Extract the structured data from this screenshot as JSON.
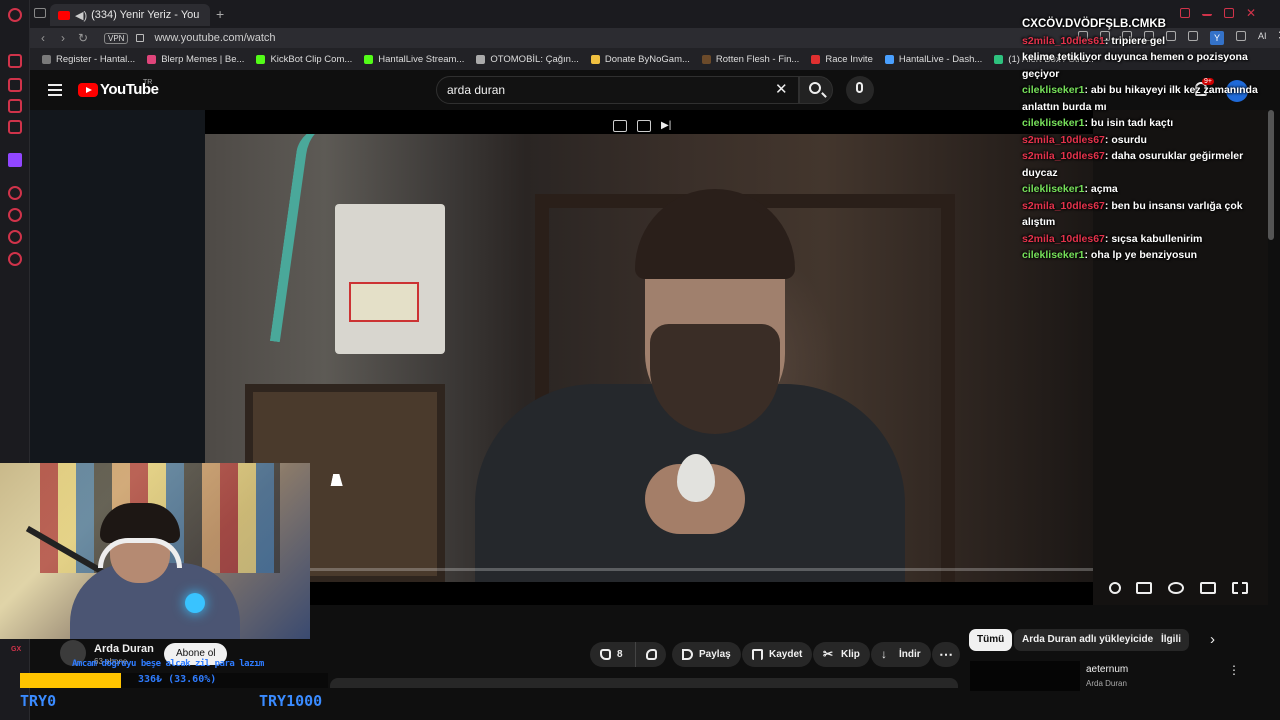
{
  "browser": {
    "tab": {
      "title": "(334) Yenir Yeriz - You"
    },
    "address": {
      "vpn_label": "VPN",
      "url": "www.youtube.com/watch"
    },
    "bookmarks": [
      {
        "label": "Register - Hantal...",
        "color": "#7a7a7a"
      },
      {
        "label": "Blerp Memes | Be...",
        "color": "#e0457b"
      },
      {
        "label": "KickBot Clip Com...",
        "color": "#53fc18"
      },
      {
        "label": "HantalLive Stream...",
        "color": "#53fc18"
      },
      {
        "label": "OTOMOBİL: Çağın...",
        "color": "#aaaaaa"
      },
      {
        "label": "Donate ByNoGam...",
        "color": "#f0c040"
      },
      {
        "label": "Rotten Flesh - Fin...",
        "color": "#6b4a2a"
      },
      {
        "label": "Race Invite",
        "color": "#e03030"
      },
      {
        "label": "HantalLive - Dash...",
        "color": "#4aa0ff"
      },
      {
        "label": "(1) Alert Box / Stre...",
        "color": "#2ec27e"
      }
    ],
    "extension_badge": "Y",
    "ai_label": "AI"
  },
  "youtube": {
    "logo_text": "YouTube",
    "country_code": "TR",
    "search_value": "arda duran",
    "notification_count": "9+",
    "channel": {
      "name": "Arda Duran",
      "subscribers": "63 abone",
      "subscribe_label": "Abone ol"
    },
    "actions": {
      "like_count": "8",
      "share": "Paylaş",
      "save": "Kaydet",
      "clip": "Klip",
      "download": "İndir"
    },
    "chips": [
      "Tümü",
      "Arda Duran adlı yükleyiciden",
      "İlgili"
    ],
    "related": {
      "title": "aeternum",
      "channel": "Arda Duran"
    }
  },
  "chat": {
    "title": "CXCÖV.DVÖDFŞLB.CMKB",
    "messages": [
      {
        "user": "s2mila_10dles61",
        "text": "tripiere gel",
        "color": "red"
      },
      {
        "user": "",
        "text": "kelime tetikliyor duyunca hemen o pozisyona geçiyor",
        "color": "red"
      },
      {
        "user": "cilekliseker1",
        "text": "abi bu hikayeyi ilk kez zamanında anlattın burda mı",
        "color": "green"
      },
      {
        "user": "cilekliseker1",
        "text": "bu isin tadı kaçtı",
        "color": "green"
      },
      {
        "user": "s2mila_10dles67",
        "text": "osurdu",
        "color": "red"
      },
      {
        "user": "s2mila_10dles67",
        "text": "daha osuruklar geğirmeler duycaz",
        "color": "red"
      },
      {
        "user": "cilekliseker1",
        "text": "açma",
        "color": "green"
      },
      {
        "user": "s2mila_10dles67",
        "text": "ben bu insansı varlığa çok alıştım",
        "color": "red"
      },
      {
        "user": "s2mila_10dles67",
        "text": "sıçsa kabullenirim",
        "color": "red"
      },
      {
        "user": "cilekliseker1",
        "text": "oha lp ye benziyosun",
        "color": "green"
      }
    ]
  },
  "stream_overlay": {
    "gx_label": "GX",
    "donation_text": "Amcam doğruyu beşe alcak zil para lazım",
    "goal_progress_text": "336₺ (33.60%)",
    "goal_fraction": 0.336,
    "goal_min": "TRY0",
    "goal_max": "TRY1000"
  }
}
